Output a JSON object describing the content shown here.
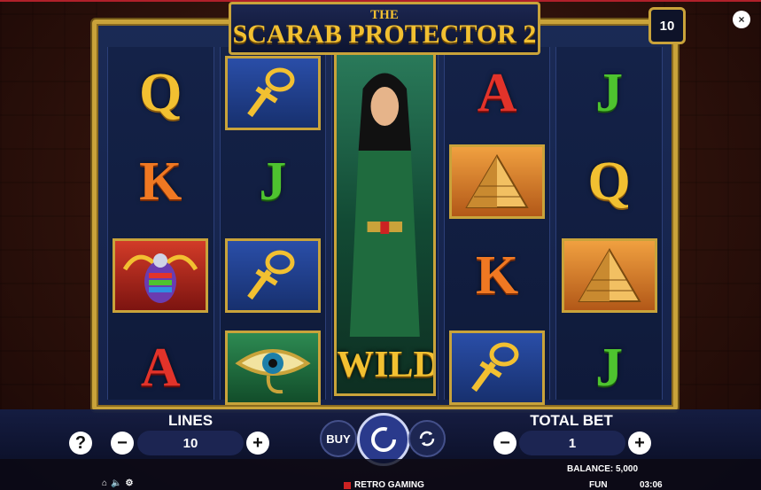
{
  "game": {
    "title_prefix": "THE",
    "title_main": "SCARAB PROTECTOR 2",
    "free_spins_badge": "10",
    "close_label": "×"
  },
  "reels": [
    {
      "symbols": [
        {
          "kind": "letter",
          "text": "Q",
          "color": "gold"
        },
        {
          "kind": "letter",
          "text": "K",
          "color": "orange"
        },
        {
          "kind": "tile",
          "name": "scarab",
          "tile": "redt"
        },
        {
          "kind": "letter",
          "text": "A",
          "color": "red"
        }
      ]
    },
    {
      "symbols": [
        {
          "kind": "tile",
          "name": "ankh",
          "tile": "blue"
        },
        {
          "kind": "letter",
          "text": "J",
          "color": "green"
        },
        {
          "kind": "tile",
          "name": "ankh",
          "tile": "blue"
        },
        {
          "kind": "tile",
          "name": "eye",
          "tile": "greent"
        }
      ]
    },
    {
      "symbols": [
        {
          "kind": "wild",
          "text": "WILD"
        }
      ]
    },
    {
      "symbols": [
        {
          "kind": "letter",
          "text": "A",
          "color": "red"
        },
        {
          "kind": "tile",
          "name": "pyramid",
          "tile": "orange"
        },
        {
          "kind": "letter",
          "text": "K",
          "color": "orange"
        },
        {
          "kind": "tile",
          "name": "ankh",
          "tile": "blue"
        }
      ]
    },
    {
      "symbols": [
        {
          "kind": "letter",
          "text": "J",
          "color": "green"
        },
        {
          "kind": "letter",
          "text": "Q",
          "color": "gold"
        },
        {
          "kind": "tile",
          "name": "pyramid",
          "tile": "orange"
        },
        {
          "kind": "letter",
          "text": "J",
          "color": "green"
        }
      ]
    }
  ],
  "controls": {
    "lines_label": "LINES",
    "lines_value": "10",
    "total_bet_label": "TOTAL BET",
    "total_bet_value": "1",
    "buy_label": "BUY",
    "help_label": "?",
    "minus": "−",
    "plus": "+"
  },
  "footer": {
    "balance_label": "BALANCE: 5,000",
    "mode": "FUN",
    "time": "03:06",
    "provider": "RETRO GAMING"
  },
  "colors": {
    "gold": "#c9a33a",
    "panel": "#15224a",
    "accent_red": "#b0202a"
  }
}
